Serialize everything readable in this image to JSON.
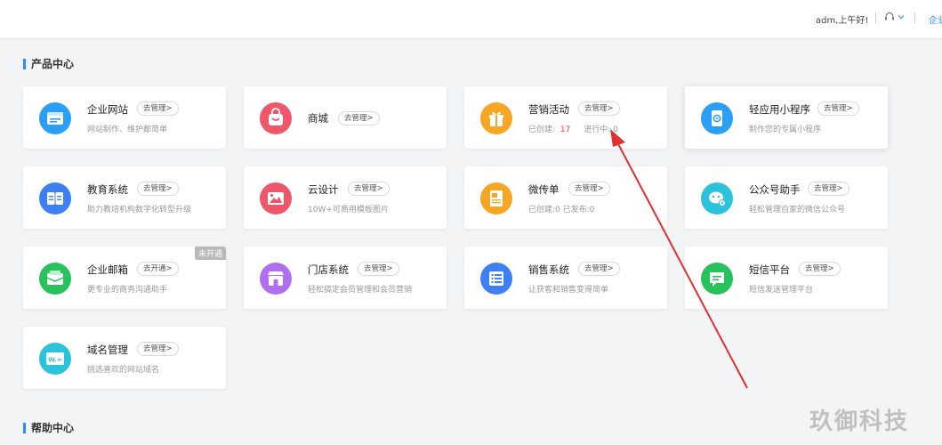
{
  "header": {
    "greeting": "adm,上午好!",
    "company_link": "企业"
  },
  "sections": {
    "product": "产品中心",
    "help": "帮助中心"
  },
  "cards": [
    {
      "name": "企业网站",
      "action": "去管理>",
      "desc": "网站制作、维护都简单",
      "icon": "website-icon",
      "color": "#2a9ff5"
    },
    {
      "name": "商城",
      "action": "去管理>",
      "desc": "",
      "icon": "mall-icon",
      "color": "#f0566a"
    },
    {
      "name": "营销活动",
      "action": "去管理>",
      "desc_label1": "已创建:",
      "desc_value1": "17",
      "desc_label2": "进行中:",
      "desc_value2": "0",
      "icon": "gift-icon",
      "color": "#f6a623"
    },
    {
      "name": "轻应用小程序",
      "action": "去管理>",
      "desc": "制作您的专属小程序",
      "icon": "mini-program-icon",
      "color": "#2a9ff5"
    },
    {
      "name": "教育系统",
      "action": "去管理>",
      "desc": "助力教培机构数字化转型升级",
      "icon": "education-icon",
      "color": "#3d7ff5"
    },
    {
      "name": "云设计",
      "action": "去管理>",
      "desc": "10W+可商用模板图片",
      "icon": "design-icon",
      "color": "#f0566a"
    },
    {
      "name": "微传单",
      "action": "去管理>",
      "desc": "已创建:0    已发布:0",
      "icon": "flyer-icon",
      "color": "#f6a623"
    },
    {
      "name": "公众号助手",
      "action": "去管理>",
      "desc": "轻松管理自家的微信公众号",
      "icon": "wechat-icon",
      "color": "#2bc3dc"
    },
    {
      "name": "企业邮箱",
      "action": "去开通>",
      "desc": "更专业的商务沟通助手",
      "badge": "未开通",
      "icon": "mail-icon",
      "color": "#27c25c"
    },
    {
      "name": "门店系统",
      "action": "去管理>",
      "desc": "轻松搞定会员管理和会员营销",
      "icon": "store-icon",
      "color": "#b06ef0"
    },
    {
      "name": "销售系统",
      "action": "去管理>",
      "desc": "让获客和销售变得简单",
      "icon": "sales-list-icon",
      "color": "#3d7ff5"
    },
    {
      "name": "短信平台",
      "action": "去管理>",
      "desc": "短信发送管理平台",
      "icon": "sms-icon",
      "color": "#27c25c"
    },
    {
      "name": "域名管理",
      "action": "去管理>",
      "desc": "挑选喜欢的网站域名",
      "icon": "domain-icon",
      "color": "#2bc3dc"
    }
  ],
  "watermark": "玖御科技",
  "annotation_color": "#e03030"
}
